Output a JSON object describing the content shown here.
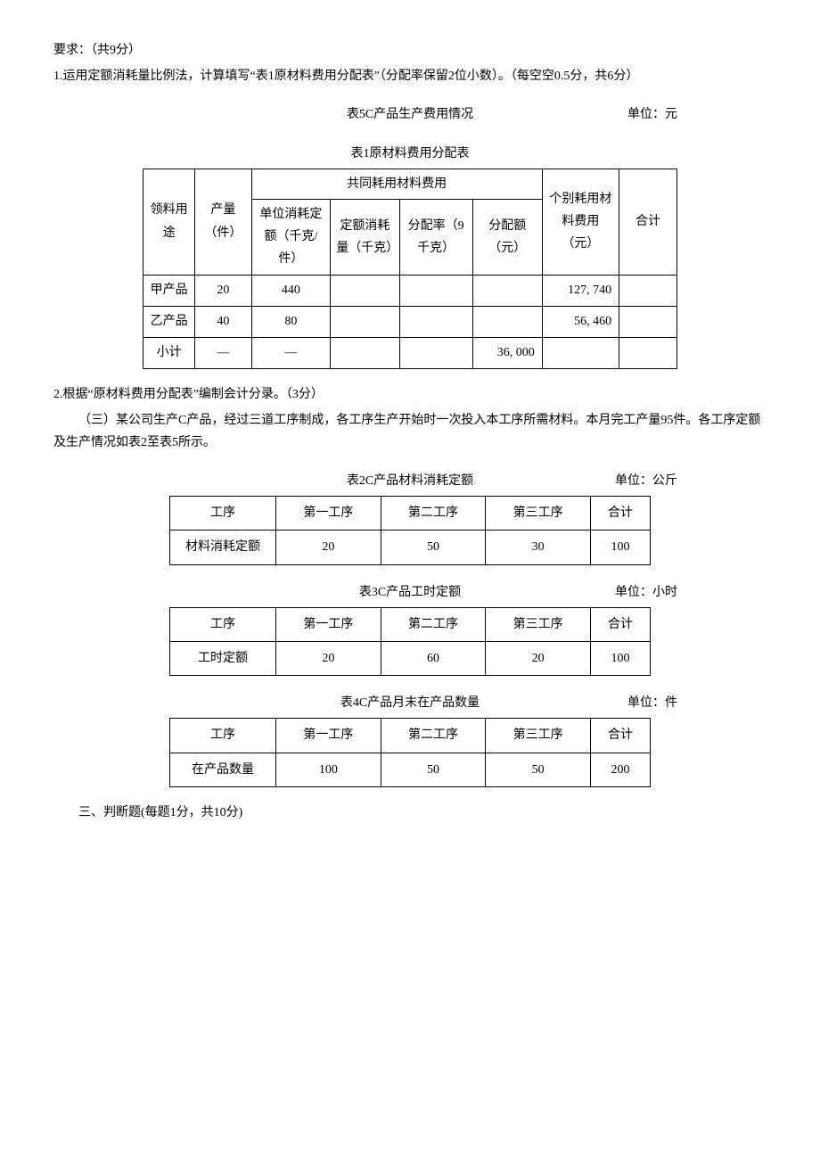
{
  "req": {
    "heading": "要求：（共9分）",
    "q1": "1.运用定额消耗量比例法，计算填写“表1原材料费用分配表”（分配率保留2位小数）。（每空空0.5分，共6分）",
    "q2": "2.根据“原材料费用分配表”编制会计分录。（3分）"
  },
  "t1": {
    "caption_t5": "表5C产品生产费用情况",
    "caption_t5_unit": "单位：元",
    "caption_t1": "表1原材料费用分配表",
    "headers": {
      "use": "领料用途",
      "qty": "产量（件）",
      "shared_group": "共同耗用材料费用",
      "unit_quota": "单位消耗定额（千克/件）",
      "quota_consume": "定额消耗量（千克）",
      "alloc_rate": "分配率（9千克）",
      "alloc_amt": "分配额（元）",
      "indiv": "个别耗用材料费用（元）",
      "total": "合计"
    },
    "rows": [
      {
        "use": "甲产品",
        "qty": "20",
        "unit_quota": "440",
        "quota_consume": "",
        "alloc_rate": "",
        "alloc_amt": "",
        "indiv": "127, 740",
        "total": ""
      },
      {
        "use": "乙产品",
        "qty": "40",
        "unit_quota": "80",
        "quota_consume": "",
        "alloc_rate": "",
        "alloc_amt": "",
        "indiv": "56, 460",
        "total": ""
      },
      {
        "use": "小计",
        "qty": "—",
        "unit_quota": "—",
        "quota_consume": "",
        "alloc_rate": "",
        "alloc_amt": "36, 000",
        "indiv": "",
        "total": ""
      }
    ]
  },
  "intro3": "（三）某公司生产C产品，经过三道工序制成，各工序生产开始时一次投入本工序所需材料。本月完工产量95件。各工序定额及生产情况如表2至表5所示。",
  "t2": {
    "title": "表2C产品材料消耗定额",
    "unit": "单位：公斤",
    "h_process": "工序",
    "h_p1": "第一工序",
    "h_p2": "第二工序",
    "h_p3": "第三工序",
    "h_total": "合计",
    "rowlabel": "材料消耗定额",
    "v1": "20",
    "v2": "50",
    "v3": "30",
    "vt": "100"
  },
  "t3": {
    "title": "表3C产品工时定额",
    "unit": "单位：小时",
    "h_process": "工序",
    "h_p1": "第一工序",
    "h_p2": "第二工序",
    "h_p3": "第三工序",
    "h_total": "合计",
    "rowlabel": "工时定额",
    "v1": "20",
    "v2": "60",
    "v3": "20",
    "vt": "100"
  },
  "t4": {
    "title": "表4C产品月末在产品数量",
    "unit": "单位：件",
    "h_process": "工序",
    "h_p1": "第一工序",
    "h_p2": "第二工序",
    "h_p3": "第三工序",
    "h_total": "合计",
    "rowlabel": "在产品数量",
    "v1": "100",
    "v2": "50",
    "v3": "50",
    "vt": "200"
  },
  "section3": "三、判断题(每题1分，共10分)"
}
